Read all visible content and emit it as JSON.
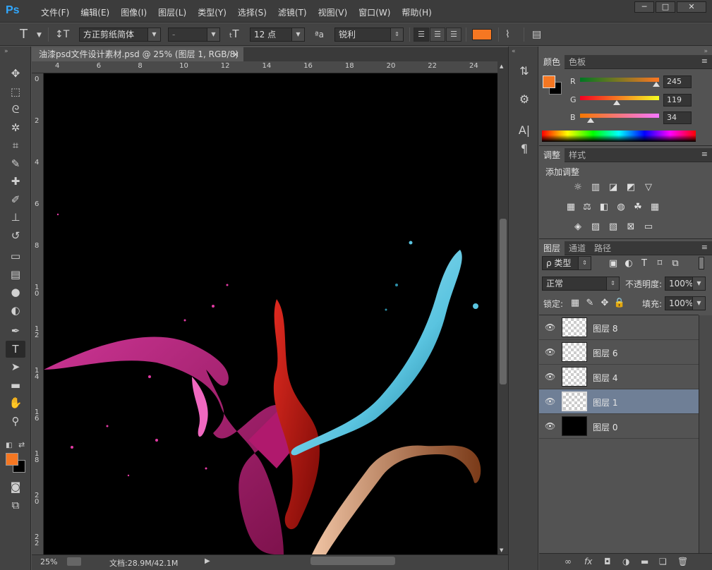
{
  "app": {
    "logo": "Ps",
    "menu": [
      "文件(F)",
      "编辑(E)",
      "图像(I)",
      "图层(L)",
      "类型(Y)",
      "选择(S)",
      "滤镜(T)",
      "视图(V)",
      "窗口(W)",
      "帮助(H)"
    ],
    "window_controls": [
      "─",
      "□",
      "✕"
    ]
  },
  "options": {
    "tool_glyph": "T",
    "font_family": "方正剪纸简体",
    "font_style": "-",
    "font_size": "12 点",
    "aa_label": "ªa",
    "antialias": "锐利",
    "text_color": "#f57722"
  },
  "document": {
    "tab_title": "油漆psd文件设计素材.psd @ 25% (图层 1, RGB/8)",
    "tab_close": "×",
    "ruler_top": [
      "4",
      "6",
      "8",
      "10",
      "12",
      "14",
      "16",
      "18",
      "20",
      "22",
      "24"
    ],
    "ruler_left": [
      "0",
      "2",
      "4",
      "6",
      "8",
      "1 0",
      "1 2",
      "1 4",
      "1 6",
      "1 8",
      "2 0",
      "2 2"
    ],
    "zoom": "25%",
    "doc_info": "文档:28.9M/42.1M"
  },
  "tools": [
    {
      "name": "move-tool",
      "glyph": "✥"
    },
    {
      "name": "marquee-tool",
      "glyph": "⬚"
    },
    {
      "name": "lasso-tool",
      "glyph": "ᘓ"
    },
    {
      "name": "quick-select-tool",
      "glyph": "✲"
    },
    {
      "name": "crop-tool",
      "glyph": "⌗"
    },
    {
      "name": "eyedropper-tool",
      "glyph": "✎"
    },
    {
      "name": "healing-tool",
      "glyph": "✚"
    },
    {
      "name": "brush-tool",
      "glyph": "✐"
    },
    {
      "name": "stamp-tool",
      "glyph": "⊥"
    },
    {
      "name": "history-brush-tool",
      "glyph": "↺"
    },
    {
      "name": "eraser-tool",
      "glyph": "▭"
    },
    {
      "name": "gradient-tool",
      "glyph": "▤"
    },
    {
      "name": "blur-tool",
      "glyph": "●"
    },
    {
      "name": "dodge-tool",
      "glyph": "◐"
    },
    {
      "name": "pen-tool",
      "glyph": "✒"
    },
    {
      "name": "type-tool",
      "glyph": "T"
    },
    {
      "name": "path-select-tool",
      "glyph": "➤"
    },
    {
      "name": "shape-tool",
      "glyph": "▬"
    },
    {
      "name": "hand-tool",
      "glyph": "✋"
    },
    {
      "name": "zoom-tool",
      "glyph": "⚲"
    }
  ],
  "swatches": {
    "foreground": "#f57722",
    "background": "#000000"
  },
  "dock": [
    "⇅",
    "⚙",
    "A|",
    "¶"
  ],
  "color_panel": {
    "tabs": [
      "颜色",
      "色板"
    ],
    "r_label": "R",
    "g_label": "G",
    "b_label": "B",
    "r": "245",
    "g": "119",
    "b": "34"
  },
  "adjust_panel": {
    "tabs": [
      "调整",
      "样式"
    ],
    "title": "添加调整"
  },
  "layers_panel": {
    "tabs": [
      "图层",
      "通道",
      "路径"
    ],
    "filter": "ρ 类型",
    "blend": "正常",
    "opacity_label": "不透明度:",
    "opacity": "100%",
    "lock_label": "锁定:",
    "fill_label": "填充:",
    "fill": "100%",
    "layers": [
      {
        "name": "图层 8",
        "selected": false
      },
      {
        "name": "图层 6",
        "selected": false
      },
      {
        "name": "图层 4",
        "selected": false
      },
      {
        "name": "图层 1",
        "selected": true
      },
      {
        "name": "图层 0",
        "selected": false
      }
    ],
    "footer": [
      "∞",
      "fx",
      "◘",
      "◑",
      "▬",
      "❏",
      "🗑"
    ]
  }
}
